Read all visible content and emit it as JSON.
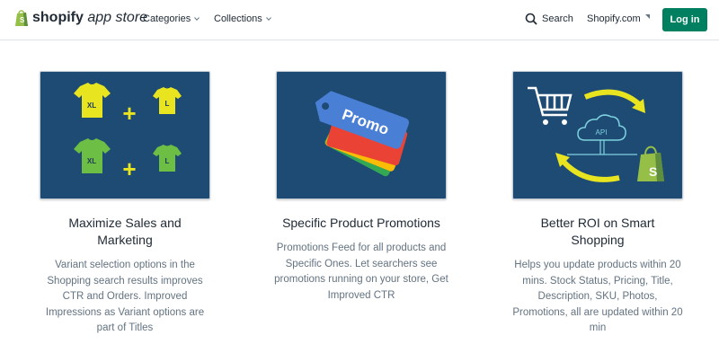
{
  "header": {
    "logo_bold": "shopify",
    "logo_rest": " app store",
    "nav": [
      {
        "label": "Categories"
      },
      {
        "label": "Collections"
      }
    ],
    "search_label": "Search",
    "shopify_link": "Shopify.com",
    "login_label": "Log in",
    "colors": {
      "accent": "#008060",
      "logo_green": "#95bf47"
    }
  },
  "features": [
    {
      "title": "Maximize Sales and Marketing",
      "description": "Variant selection options in the Shopping search results improves CTR and Orders. Improved Impressions as Variant options are part of Titles",
      "image": {
        "icon": "tshirt-variants-icon",
        "shirt_labels": [
          "XL",
          "L",
          "XL",
          "L"
        ],
        "plus": "+"
      }
    },
    {
      "title": "Specific Product Promotions",
      "description": "Promotions Feed for all products and Specific Ones. Let searchers see promotions running on your store, Get Improved CTR",
      "image": {
        "icon": "promo-tags-icon",
        "tag_label": "Promo"
      }
    },
    {
      "title": "Better ROI on Smart Shopping",
      "description": "Helps you update products within 20 mins. Stock Status, Pricing, Title, Description, SKU, Photos, Promotions, all are updated within 20 min",
      "image": {
        "icon": "api-sync-icon",
        "cloud_label": "API"
      }
    }
  ],
  "colors": {
    "card_bg": "#1d4b73",
    "title": "#212b36",
    "description": "#637381"
  }
}
